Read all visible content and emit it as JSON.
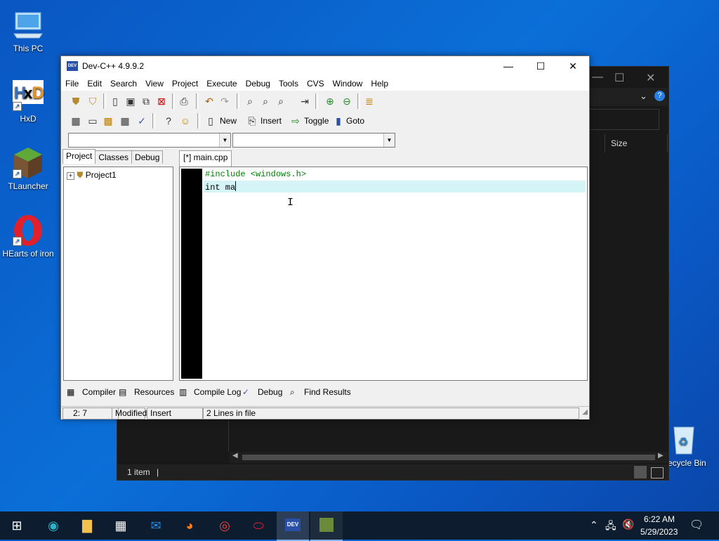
{
  "desktop": {
    "icons": [
      {
        "label": "This PC"
      },
      {
        "label": "HxD"
      },
      {
        "label": "TLauncher"
      },
      {
        "label": "HEarts of iron"
      },
      {
        "label": "Recycle Bin"
      }
    ]
  },
  "explorer": {
    "column_size": "Size",
    "status_items": "1 item"
  },
  "window": {
    "title": "Dev-C++ 4.9.9.2",
    "app_icon": "DEV",
    "menu": [
      "File",
      "Edit",
      "Search",
      "View",
      "Project",
      "Execute",
      "Debug",
      "Tools",
      "CVS",
      "Window",
      "Help"
    ],
    "toolbar2_labels": {
      "new": "New",
      "insert": "Insert",
      "toggle": "Toggle",
      "goto": "Goto"
    },
    "left_tabs": [
      "Project",
      "Classes",
      "Debug"
    ],
    "project_tree_root": "Project1",
    "editor_tab": "[*] main.cpp",
    "code_lines": [
      "#include <windows.h>",
      "int ma"
    ],
    "bottom_tabs": [
      "Compiler",
      "Resources",
      "Compile Log",
      "Debug",
      "Find Results"
    ],
    "status": {
      "position": "2: 7",
      "state": "Modified",
      "mode": "Insert",
      "lines": "2 Lines in file"
    }
  },
  "taskbar": {
    "time": "6:22 AM",
    "date": "5/29/2023",
    "dev_icon": "DEV"
  },
  "colors": {
    "current_line": "#d4f4f7",
    "directive": "#008000",
    "taskbar": "#0d1c2e"
  }
}
